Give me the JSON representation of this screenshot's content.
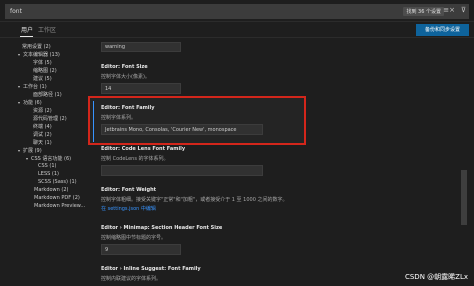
{
  "search": {
    "value": "font",
    "count_badge": "找到 36 个设置",
    "clear_glyph": "≡×",
    "filter_glyph": "⊽"
  },
  "tabs": [
    {
      "label": "用户",
      "active": true
    },
    {
      "label": "工作区",
      "active": false
    }
  ],
  "sync_button_label": "备份和同步设置",
  "tree": [
    {
      "label": "常用设置 (2)",
      "expanded": null
    },
    {
      "label": "文本编辑器 (13)",
      "expanded": true
    },
    {
      "label": "字体 (5)",
      "expanded": null
    },
    {
      "label": "缩略图 (2)",
      "expanded": null
    },
    {
      "label": "建议 (5)",
      "expanded": null
    },
    {
      "label": "工作台 (1)",
      "expanded": true
    },
    {
      "label": "面部路径 (1)",
      "expanded": null
    },
    {
      "label": "功能 (6)",
      "expanded": true
    },
    {
      "label": "资源 (2)",
      "expanded": null
    },
    {
      "label": "源代码管理 (2)",
      "expanded": null
    },
    {
      "label": "终端 (4)",
      "expanded": null
    },
    {
      "label": "调试 (2)",
      "expanded": null
    },
    {
      "label": "聊天 (1)",
      "expanded": null
    },
    {
      "label": "扩展 (9)",
      "expanded": true
    },
    {
      "label": "CSS 语言功能 (6)",
      "expanded": true
    },
    {
      "label": "CSS (1)",
      "expanded": null
    },
    {
      "label": "LESS (1)",
      "expanded": null
    },
    {
      "label": "SCSS (Sass) (1)",
      "expanded": null
    },
    {
      "label": "Markdown (2)",
      "expanded": null
    },
    {
      "label": "Markdown PDF (2)",
      "expanded": null
    },
    {
      "label": "Markdown Preview...",
      "expanded": null
    }
  ],
  "settings": {
    "top_select_value": "warning",
    "font_size": {
      "title": "Editor: Font Size",
      "desc": "控制字体大小(像素)。",
      "value": "14"
    },
    "font_family": {
      "title": "Editor: Font Family",
      "desc": "控制字体系列。",
      "value": "Jetbrains Mono, Consolas, 'Courier New', monospace"
    },
    "code_lens": {
      "title": "Editor: Code Lens Font Family",
      "desc": "控制 CodeLens 的字体系列。",
      "value": ""
    },
    "font_weight": {
      "title": "Editor: Font Weight",
      "desc": "控制字体粗细。接受关键字\"正常\"和\"加粗\"，或者接受介于 1 至 1000 之间的数字。",
      "link": "在 settings.json 中编辑"
    },
    "minimap_header": {
      "title": "Editor › Minimap: Section Header Font Size",
      "desc": "控制缩略图中节标题的字号。",
      "value": "9"
    },
    "inline_suggest": {
      "title": "Editor › Inline Suggest: Font Family",
      "desc": "控制内联建议的字体系列。"
    }
  },
  "watermark": "CSDN @朝露晞ZLx",
  "colors": {
    "highlight_border": "#d3261b",
    "accent": "#0e639c",
    "link": "#3794ff"
  }
}
